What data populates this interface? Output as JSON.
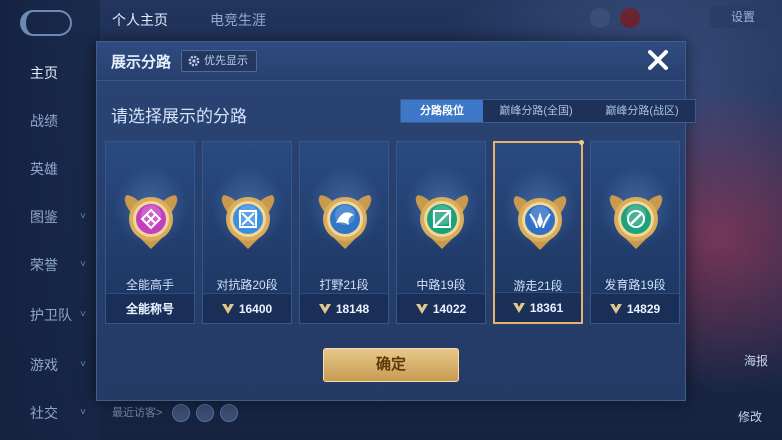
{
  "background": {
    "sidebar": [
      {
        "label": "主页",
        "active": true
      },
      {
        "label": "战绩",
        "active": false
      },
      {
        "label": "英雄",
        "active": false
      },
      {
        "label": "图鉴",
        "active": false,
        "has_chevron": true
      },
      {
        "label": "荣誉",
        "active": false,
        "has_chevron": true
      },
      {
        "label": "护卫队",
        "active": false,
        "has_chevron": true
      },
      {
        "label": "游戏",
        "active": false,
        "has_chevron": true
      },
      {
        "label": "社交",
        "active": false,
        "has_chevron": true
      }
    ],
    "top_tabs": [
      "个人主页",
      "电竞生涯"
    ],
    "settings_label": "设置",
    "visitor_label": "最近访客>",
    "right_buttons": [
      "海报",
      "修改"
    ]
  },
  "modal": {
    "title": "展示分路",
    "priority_label": "优先显示",
    "subtitle": "请选择展示的分路",
    "tabs": [
      {
        "label": "分路段位",
        "active": true
      },
      {
        "label": "巅峰分路(全国)",
        "active": false
      },
      {
        "label": "巅峰分路(战区)",
        "active": false
      }
    ],
    "cards": [
      {
        "name": "全能高手",
        "foot": "全能称号",
        "show_icon": false,
        "selected": false,
        "badge_color": "#c23fbf",
        "emblem": "omni"
      },
      {
        "name": "对抗路20段",
        "foot": "16400",
        "show_icon": true,
        "selected": false,
        "badge_color": "#3a8fe0",
        "emblem": "clash"
      },
      {
        "name": "打野21段",
        "foot": "18148",
        "show_icon": true,
        "selected": false,
        "badge_color": "#2f76c9",
        "emblem": "jungle"
      },
      {
        "name": "中路19段",
        "foot": "14022",
        "show_icon": true,
        "selected": false,
        "badge_color": "#1aa37a",
        "emblem": "mid"
      },
      {
        "name": "游走21段",
        "foot": "18361",
        "show_icon": true,
        "selected": true,
        "badge_color": "#2f6fc5",
        "emblem": "roam"
      },
      {
        "name": "发育路19段",
        "foot": "14829",
        "show_icon": true,
        "selected": false,
        "badge_color": "#1ea27c",
        "emblem": "farm"
      }
    ],
    "confirm_label": "确定"
  },
  "colors": {
    "accent_blue": "#3d78c8",
    "gold": "#e7b36c",
    "confirm_gold": "#c89a52"
  }
}
